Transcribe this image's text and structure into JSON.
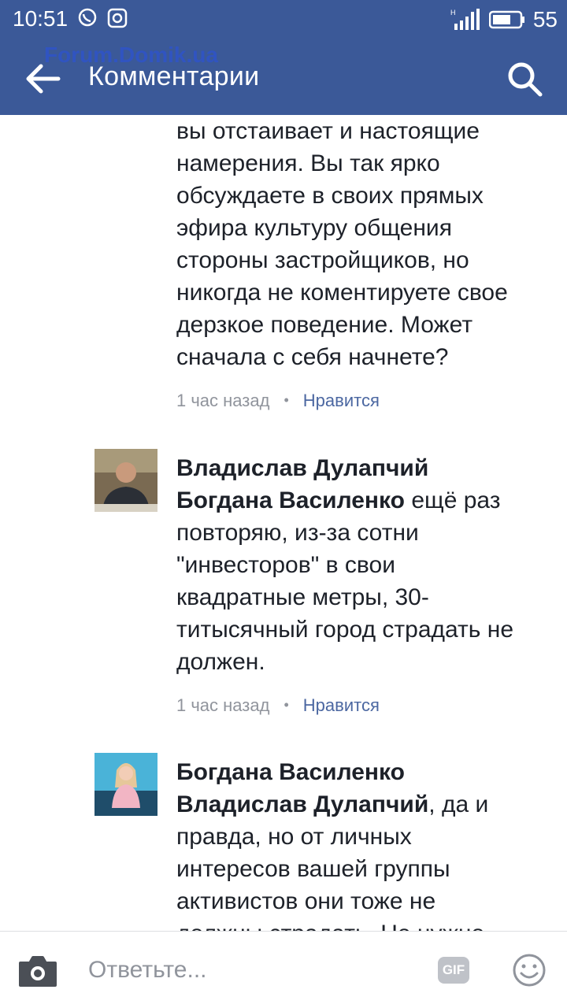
{
  "status_bar": {
    "time": "10:51",
    "battery": "55",
    "network": "H"
  },
  "app_bar": {
    "title": "Комментарии",
    "watermark": "Forum.Domik.ua"
  },
  "comments": [
    {
      "partial": true,
      "lines": [
        "вы отстаивает и настоящие",
        "намерения.  Вы так ярко",
        "обсуждаете в своих прямых",
        "эфира культуру общения",
        "стороны застройщиков, но",
        "никогда не коментируете свое",
        "дерзкое поведение. Может",
        "сначала с себя начнете?"
      ],
      "time": "1 час назад",
      "like": "Нравится"
    },
    {
      "author": "Владислав Дулапчий",
      "mention": "Богдана Василенко",
      "text_first": " ещё раз",
      "lines": [
        "повторяю, из-за сотни",
        "\"инвесторов\" в свои",
        "квадратные метры, 30-",
        "титысячный город страдать не",
        "должен."
      ],
      "time": "1 час назад",
      "like": "Нравится"
    },
    {
      "author": "Богдана Василенко",
      "mention": "Владислав Дулапчий",
      "text_first": ", да и",
      "lines": [
        "правда,  но от личных",
        "интересов вашей группы",
        "активистов они тоже не",
        "должны страдать. Не нужно"
      ]
    }
  ],
  "composer": {
    "placeholder": "Ответьте...",
    "gif": "GIF"
  },
  "colors": {
    "brand": "#3b5998",
    "meta": "#90949c",
    "like": "#4b67a1"
  }
}
